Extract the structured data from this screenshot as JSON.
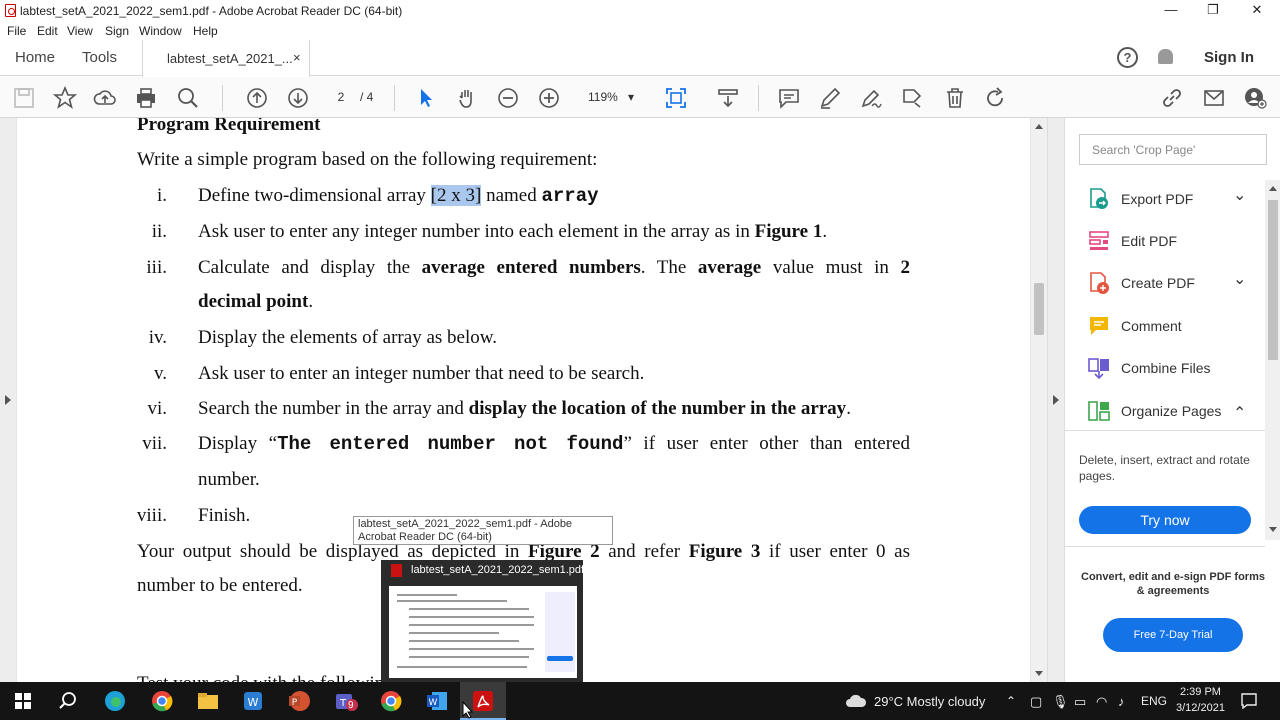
{
  "window": {
    "title": "labtest_setA_2021_2022_sem1.pdf - Adobe Acrobat Reader DC (64-bit)",
    "minimize": "—",
    "restore": "❐",
    "close": "✕"
  },
  "menu": [
    "File",
    "Edit",
    "View",
    "Sign",
    "Window",
    "Help"
  ],
  "tabs": {
    "home": "Home",
    "tools": "Tools",
    "doc": "labtest_setA_2021_...",
    "doc_close": "×",
    "help": "?",
    "signin": "Sign In"
  },
  "toolbar": {
    "page_current": "2",
    "page_total": "/ 4",
    "zoom": "119%",
    "zoom_caret": "▾",
    "icons": [
      "save-icon",
      "bookmark-star-icon",
      "upload-cloud-icon",
      "print-icon",
      "find-icon",
      "page-up-icon",
      "page-down-icon",
      "select-cursor-icon",
      "hand-icon",
      "zoom-out-icon",
      "zoom-in-icon",
      "fit-page-icon",
      "scroll-mode-icon",
      "comment-icon",
      "highlight-pen-icon",
      "fill-sign-icon",
      "stamp-icon",
      "delete-icon",
      "rotate-icon",
      "share-link-icon",
      "email-icon",
      "add-user-icon"
    ]
  },
  "doc": {
    "heading": "Program Requirement",
    "intro": "Write a simple program based on the following requirement:",
    "items": {
      "i": {
        "num": "i.",
        "a": "Define two-dimensional array ",
        "hl": "[2 x 3]",
        "b": " named ",
        "code": "array"
      },
      "ii": {
        "num": "ii.",
        "a": "Ask user to enter any integer number into each element in the array as in ",
        "bold": "Figure 1",
        "b": "."
      },
      "iii": {
        "num": "iii.",
        "a": "Calculate and display the ",
        "bold1": "average entered numbers",
        "b": ". The ",
        "bold2": "average",
        "c": " value must in ",
        "bold3": "2",
        "line2bold": "decimal point",
        "line2end": "."
      },
      "iv": {
        "num": "iv.",
        "a": "Display the elements of array as below."
      },
      "v": {
        "num": "v.",
        "a": "Ask user to enter an integer number that need to be search."
      },
      "vi": {
        "num": "vi.",
        "a": "Search the number in the array and ",
        "bold": "display the location of the number in the array",
        "b": "."
      },
      "vii": {
        "num": "vii.",
        "a": "Display “",
        "code": "The entered number not found",
        "b": "” if user enter other than entered",
        "line2": "number."
      },
      "viii": {
        "num": "viii.",
        "a": "Finish."
      }
    },
    "output1a": "Your output should be displayed as depicted in ",
    "output1bold1": "Figure 2",
    "output1b": " and refer ",
    "output1bold2": "Figure 3",
    "output1c": " if user enter 0 as",
    "output2": "number to be entered.",
    "cut": "Test your code with the following"
  },
  "tooltip": "labtest_setA_2021_2022_sem1.pdf - Adobe Acrobat Reader DC (64-bit)",
  "thumbnail_title": "labtest_setA_2021_2022_sem1.pdf",
  "right_panel": {
    "search_placeholder": "Search 'Crop Page'",
    "tools": [
      {
        "label": "Export PDF",
        "chevron": "⌄",
        "color": "#1a9c8c"
      },
      {
        "label": "Edit PDF",
        "chevron": "",
        "color": "#e44a7b"
      },
      {
        "label": "Create PDF",
        "chevron": "⌄",
        "color": "#e4553f"
      },
      {
        "label": "Comment",
        "chevron": "",
        "color": "#f2b705"
      },
      {
        "label": "Combine Files",
        "chevron": "",
        "color": "#6b5ccf"
      },
      {
        "label": "Organize Pages",
        "chevron": "⌃",
        "color": "#3da74e"
      }
    ],
    "organize_desc": "Delete, insert, extract and rotate pages.",
    "try_now": "Try now",
    "promo": "Convert, edit and e-sign PDF forms & agreements",
    "trial": "Free 7-Day Trial"
  },
  "taskbar": {
    "weather": "29°C  Mostly cloudy",
    "lang": "ENG",
    "time": "2:39 PM",
    "date": "3/12/2021",
    "teams_badge": "9"
  },
  "colors": {
    "accent": "#1473e6",
    "acrobat_red": "#c11",
    "taskbar": "#141414"
  }
}
